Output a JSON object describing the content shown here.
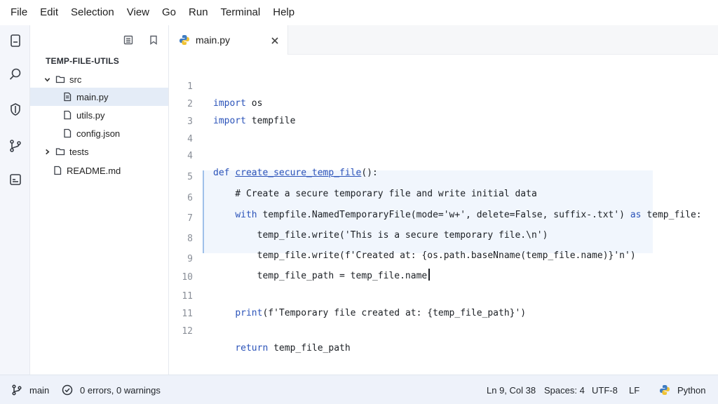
{
  "menu": [
    "File",
    "Edit",
    "Selection",
    "View",
    "Go",
    "Run",
    "Terminal",
    "Help"
  ],
  "activity_bar": [
    {
      "name": "explorer-icon"
    },
    {
      "name": "search-icon"
    },
    {
      "name": "shield-icon"
    },
    {
      "name": "source-control-icon"
    },
    {
      "name": "extensions-icon"
    }
  ],
  "explorer": {
    "title": "TEMP-FILE-UTILS",
    "tree": [
      {
        "label": "src",
        "type": "folder",
        "expanded": true,
        "depth": 0
      },
      {
        "label": "main.py",
        "type": "file",
        "depth": 1,
        "selected": true
      },
      {
        "label": "utils.py",
        "type": "file",
        "depth": 1
      },
      {
        "label": "config.json",
        "type": "file",
        "depth": 1
      },
      {
        "label": "tests",
        "type": "folder",
        "expanded": false,
        "depth": 0
      },
      {
        "label": "README.md",
        "type": "file",
        "depth": 0
      }
    ]
  },
  "tabs": [
    {
      "label": "main.py",
      "icon": "python-icon",
      "active": true
    }
  ],
  "editor": {
    "lines": [
      {
        "num": "1",
        "text": "import os"
      },
      {
        "num": "2",
        "text": "import tempfile"
      },
      {
        "num": "3",
        "text": ""
      },
      {
        "num": "4",
        "text": ""
      },
      {
        "num": "4b",
        "text": "def create_secure_temp_file():"
      },
      {
        "num": "5",
        "text": "    # Create a secure temporary file and write initial data"
      },
      {
        "num": "6",
        "text": "    with tempfile.NamedTemporaryFile(mode='w+', delete=False, suffix-.txt') as temp_file:"
      },
      {
        "num": "7",
        "text": "        temp_file.write('This is a secure temporary file.\\n')"
      },
      {
        "num": "8",
        "text": "        temp_file.write(f'Created at: {os.path.baseNname(temp_file.name)}'n')"
      },
      {
        "num": "9",
        "text": "        temp_file_path = temp_file.name"
      },
      {
        "num": "10",
        "text": ""
      },
      {
        "num": "11",
        "text": "    print(f'Temporary file created at: {temp_file_path}')"
      },
      {
        "num": "11b",
        "text": ""
      },
      {
        "num": "12",
        "text": "    return temp_file_path"
      }
    ],
    "gutter": [
      "1",
      "2",
      "3",
      "4",
      "4",
      "5",
      "6",
      "7",
      "8",
      "9",
      "10",
      "11",
      "11",
      "12"
    ]
  },
  "status": {
    "branch": "main",
    "problems": "0 errors, 0 warnings",
    "position": "Ln 9, Col 38",
    "spaces": "Spaces: 4",
    "encoding": "UTF-8",
    "eol": "LF",
    "language": "Python"
  }
}
